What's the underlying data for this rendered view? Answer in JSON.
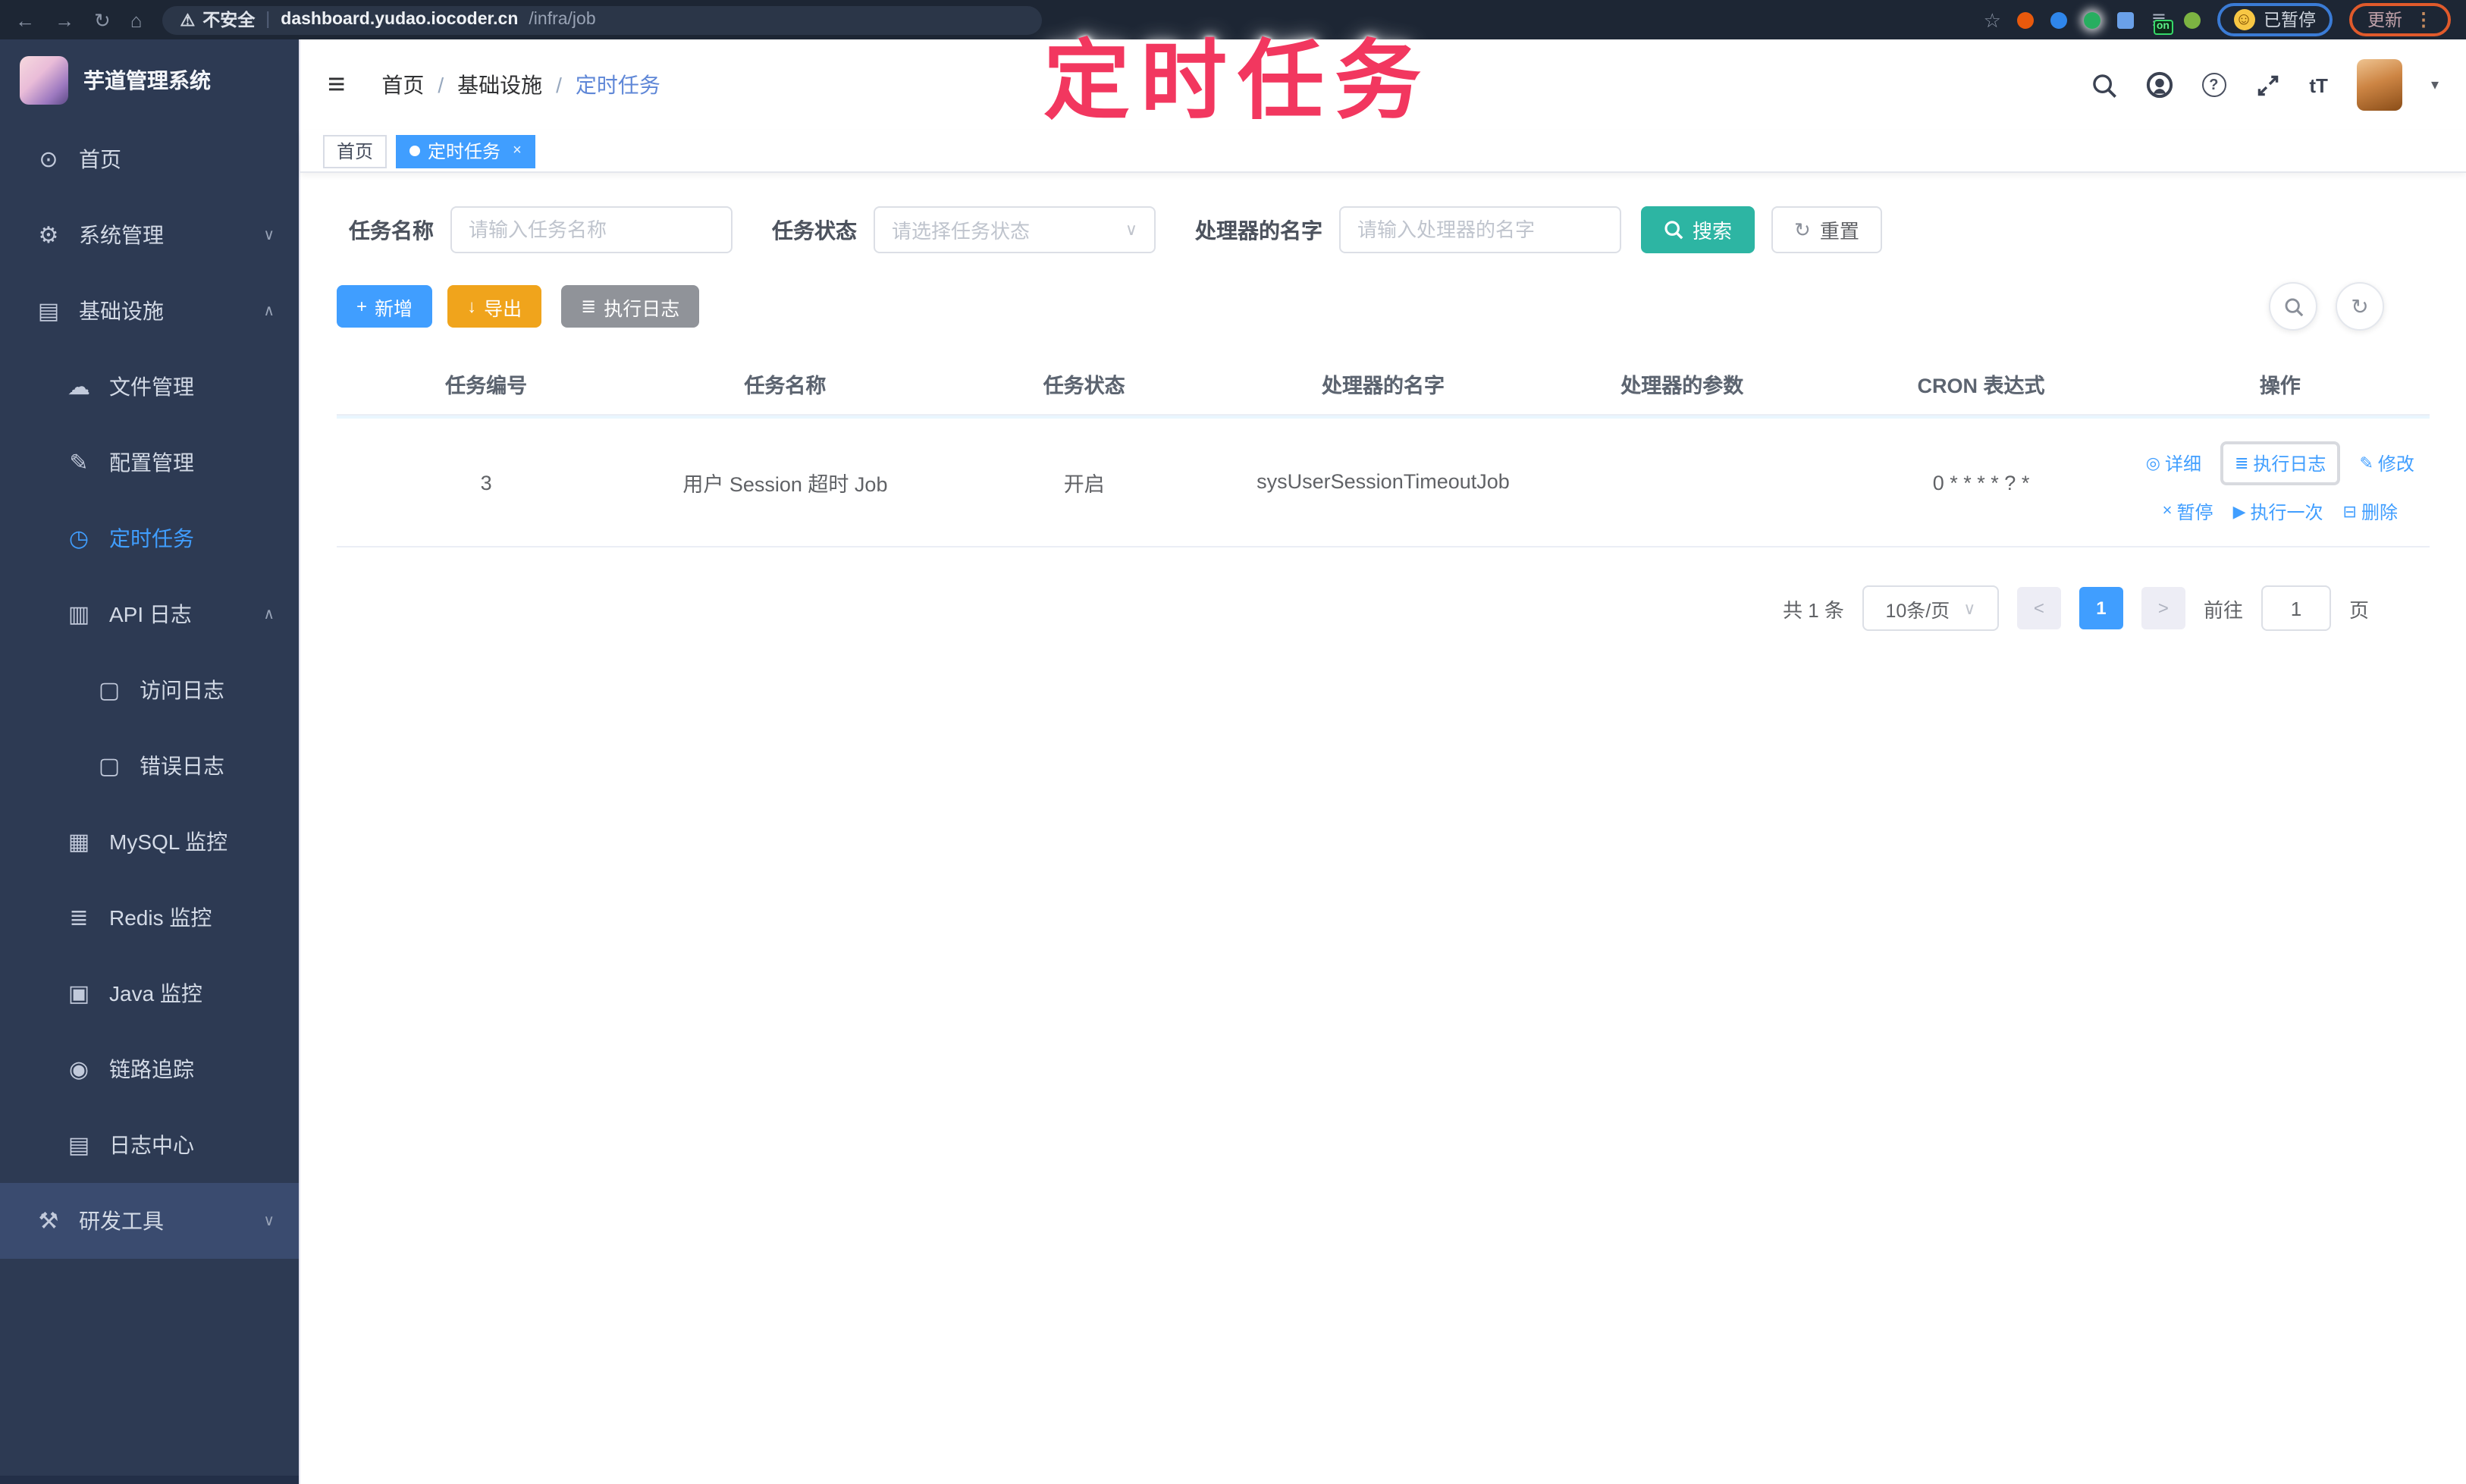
{
  "browser": {
    "security_label": "不安全",
    "url_host": "dashboard.yudao.iocoder.cn",
    "url_path": "/infra/job",
    "extension_on_badge": "on",
    "paused_label": "已暂停",
    "update_label": "更新"
  },
  "annotation": {
    "title": "定时任务"
  },
  "sidebar": {
    "app_title": "芋道管理系统",
    "items": [
      {
        "label": "首页",
        "icon": "dashboard-icon",
        "level": 1
      },
      {
        "label": "系统管理",
        "icon": "gear-icon",
        "level": 1,
        "chevron": "down"
      },
      {
        "label": "基础设施",
        "icon": "infrastructure-icon",
        "level": 1,
        "chevron": "up"
      },
      {
        "label": "文件管理",
        "icon": "cloud-upload-icon",
        "level": 2
      },
      {
        "label": "配置管理",
        "icon": "edit-icon",
        "level": 2
      },
      {
        "label": "定时任务",
        "icon": "timer-icon",
        "level": 2,
        "active": true
      },
      {
        "label": "API 日志",
        "icon": "api-log-icon",
        "level": 2,
        "chevron": "up"
      },
      {
        "label": "访问日志",
        "icon": "access-log-icon",
        "level": 3
      },
      {
        "label": "错误日志",
        "icon": "error-log-icon",
        "level": 3
      },
      {
        "label": "MySQL 监控",
        "icon": "mysql-icon",
        "level": 2
      },
      {
        "label": "Redis 监控",
        "icon": "redis-icon",
        "level": 2
      },
      {
        "label": "Java 监控",
        "icon": "java-icon",
        "level": 2
      },
      {
        "label": "链路追踪",
        "icon": "trace-icon",
        "level": 2
      },
      {
        "label": "日志中心",
        "icon": "log-center-icon",
        "level": 2
      },
      {
        "label": "研发工具",
        "icon": "toolbox-icon",
        "level": 1,
        "chevron": "down"
      }
    ]
  },
  "header": {
    "breadcrumb": {
      "home": "首页",
      "section": "基础设施",
      "current": "定时任务"
    },
    "separator": "/",
    "font_size_glyph": "tT",
    "help_glyph": "?",
    "tags": [
      {
        "label": "首页",
        "active": false
      },
      {
        "label": "定时任务",
        "active": true,
        "close_glyph": "×"
      }
    ]
  },
  "filters": {
    "task_name_label": "任务名称",
    "task_name_placeholder": "请输入任务名称",
    "task_status_label": "任务状态",
    "task_status_placeholder": "请选择任务状态",
    "handler_name_label": "处理器的名字",
    "handler_name_placeholder": "请输入处理器的名字",
    "search_label": "搜索",
    "reset_label": "重置"
  },
  "toolbar": {
    "add_label": "新增",
    "export_label": "导出",
    "exec_log_label": "执行日志"
  },
  "table": {
    "columns": {
      "c0": "任务编号",
      "c1": "任务名称",
      "c2": "任务状态",
      "c3": "处理器的名字",
      "c4": "处理器的参数",
      "c5": "CRON 表达式",
      "c6": "操作"
    },
    "rows": [
      {
        "id": "3",
        "name": "用户 Session 超时 Job",
        "status": "开启",
        "handler": "sysUserSessionTimeoutJob",
        "param": "",
        "cron": "0 * * * * ? *",
        "actions": {
          "detail": "详细",
          "exec_log": "执行日志",
          "edit": "修改",
          "pause": "暂停",
          "run_once": "执行一次",
          "delete": "删除"
        }
      }
    ]
  },
  "pagination": {
    "total": "共 1 条",
    "page_size": "10条/页",
    "current_page": "1",
    "goto_label": "前往",
    "goto_value": "1",
    "page_unit": "页"
  },
  "colors": {
    "accent": "#409eff",
    "search_button": "#2db5a3",
    "export_button": "#f0a41c",
    "info_button": "#909399",
    "sidebar_bg": "#2d3a53",
    "annotation": "#f2375f"
  }
}
